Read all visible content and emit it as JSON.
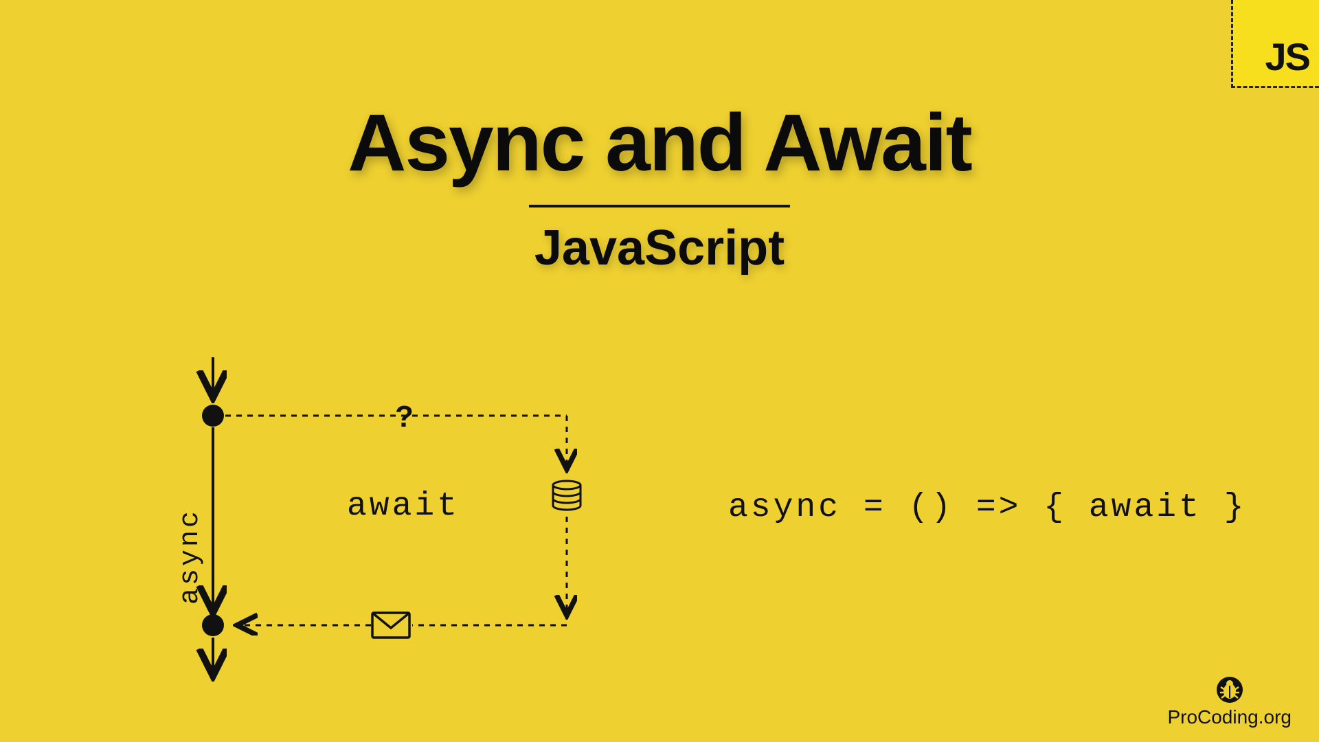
{
  "badge": {
    "label": "JS"
  },
  "title": "Async and Await",
  "subtitle": "JavaScript",
  "diagram": {
    "async_label": "async",
    "await_label": "await",
    "question_mark": "?",
    "database_icon": "database-icon",
    "envelope_icon": "envelope-icon"
  },
  "code_snippet": "async = () => { await }",
  "attribution": {
    "icon": "bug-icon",
    "text": "ProCoding.org"
  },
  "colors": {
    "background": "#eed030",
    "badge_bg": "#f7df1e",
    "text": "#0b0b0b"
  }
}
